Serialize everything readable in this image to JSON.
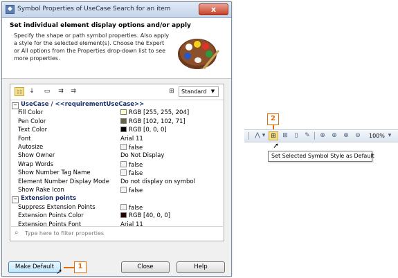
{
  "dialog": {
    "title": "Symbol Properties of UseCase Search for an item",
    "close_glyph": "x",
    "header_title": "Set individual element display options and/or apply",
    "header_desc": "Specify the shape or path symbol properties. Also apply a style for the selected element(s). Choose the Expert or All options from the Properties drop-down list to see more properties.",
    "mode_select": "Standard",
    "groups": [
      {
        "name": "UseCase / <<requirementUseCase>>",
        "rows": [
          {
            "key": "Fill Color",
            "value": "RGB [255, 255, 204]",
            "swatch": "#ffffcc"
          },
          {
            "key": "Pen Color",
            "value": "RGB [102, 102, 71]",
            "swatch": "#666647"
          },
          {
            "key": "Text Color",
            "value": "RGB [0, 0, 0]",
            "swatch": "#000000"
          },
          {
            "key": "Font",
            "value": "Arial 11"
          },
          {
            "key": "Autosize",
            "value": "false",
            "checkbox": true
          },
          {
            "key": "Show Owner",
            "value": "Do Not Display"
          },
          {
            "key": "Wrap Words",
            "value": "false",
            "checkbox": true
          },
          {
            "key": "Show Number Tag Name",
            "value": "false",
            "checkbox": true
          },
          {
            "key": "Element Number Display Mode",
            "value": "Do not display on symbol"
          },
          {
            "key": "Show Rake Icon",
            "value": "false",
            "checkbox": true
          }
        ]
      },
      {
        "name": "Extension points",
        "rows": [
          {
            "key": "Suppress Extension Points",
            "value": "false",
            "checkbox": true
          },
          {
            "key": "Extension Points Color",
            "value": "RGB [40, 0, 0]",
            "swatch": "#280000"
          },
          {
            "key": "Extension Points Font",
            "value": "Arial 11"
          }
        ]
      }
    ],
    "filter_placeholder": "Type here to filter properties",
    "buttons": {
      "make_default": "Make Default",
      "close": "Close",
      "help": "Help"
    }
  },
  "callouts": {
    "one": "1",
    "two": "2"
  },
  "toolbar": {
    "zoom": "100%"
  },
  "tooltip": "Set Selected Symbol Style as Default",
  "colors": {
    "callout": "#e36c09",
    "title_bar": "#c5d5ea",
    "close_button": "#c7432b"
  }
}
